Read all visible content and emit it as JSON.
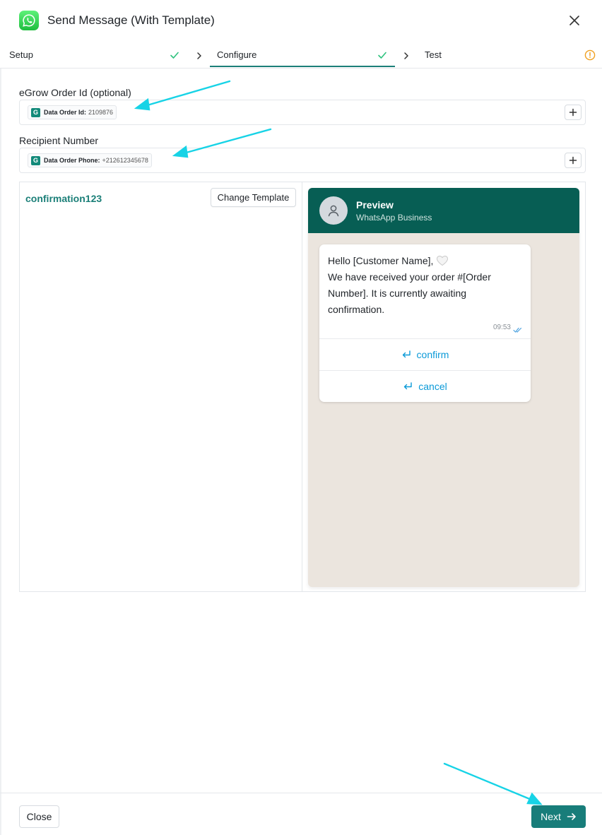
{
  "header": {
    "title": "Send Message (With Template)",
    "logo_icon": "whatsapp-icon",
    "close_icon": "close-icon"
  },
  "steps": [
    {
      "label": "Setup",
      "status": "done"
    },
    {
      "label": "Configure",
      "status": "done",
      "active": true
    },
    {
      "label": "Test",
      "status": "warning"
    }
  ],
  "fields": {
    "order_id": {
      "label": "eGrow Order Id (optional)",
      "chip_key": "Data Order Id:",
      "chip_value": "2109876"
    },
    "recipient": {
      "label": "Recipient Number",
      "chip_key": "Data Order Phone:",
      "chip_value": "+212612345678"
    },
    "chip_badge": "G"
  },
  "template": {
    "name": "confirmation123",
    "change_label": "Change Template"
  },
  "preview": {
    "title": "Preview",
    "subtitle": "WhatsApp Business",
    "message_line1": "Hello [Customer Name],",
    "message_line2": "We have received your order #[Order Number]. It is currently awaiting confirmation.",
    "time": "09:53",
    "buttons": [
      {
        "label": "confirm"
      },
      {
        "label": "cancel"
      }
    ]
  },
  "footer": {
    "close_label": "Close",
    "next_label": "Next"
  },
  "colors": {
    "accent": "#187d7a",
    "whatsapp_header": "#075e54",
    "chat_background": "#ebe5de",
    "link_blue": "#0b9ad8",
    "annotation_arrow": "#17d3e6"
  }
}
